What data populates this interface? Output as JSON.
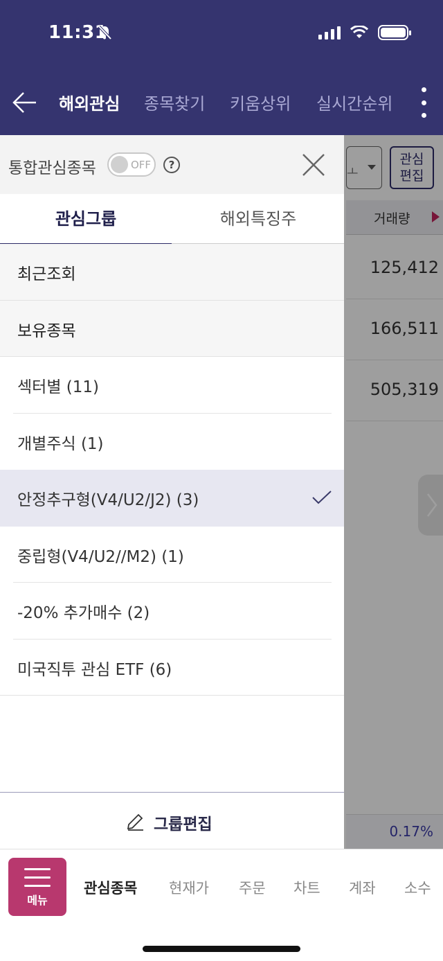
{
  "status_bar": {
    "time": "11:31"
  },
  "nav": {
    "tabs": [
      {
        "label": "해외관심",
        "active": true
      },
      {
        "label": "종목찾기",
        "active": false
      },
      {
        "label": "키움상위",
        "active": false
      },
      {
        "label": "실시간순위",
        "active": false
      }
    ]
  },
  "background": {
    "edit_button": "관심\n편집",
    "column_header": "거래량",
    "rows": [
      "125,412",
      "166,511",
      "505,319"
    ],
    "footer_percent": "0.17%",
    "select_fragment": "ㅗ"
  },
  "drawer": {
    "integrated_label": "통합관심종목",
    "toggle_text": "OFF",
    "help_text": "?",
    "tabs": [
      {
        "label": "관심그룹",
        "active": true
      },
      {
        "label": "해외특징주",
        "active": false
      }
    ],
    "items": [
      {
        "label": "최근조회"
      },
      {
        "label": "보유종목"
      },
      {
        "label": "섹터별 (11)"
      },
      {
        "label": "개별주식 (1)"
      },
      {
        "label": "안정추구형(V4/U2/J2) (3)",
        "selected": true
      },
      {
        "label": "중립형(V4/U2//M2) (1)"
      },
      {
        "label": "-20% 추가매수 (2)"
      },
      {
        "label": "미국직투 관심 ETF (6)"
      }
    ],
    "group_edit_label": "그룹편집"
  },
  "bottom_nav": {
    "menu_label": "메뉴",
    "tabs": [
      {
        "label": "관심종목",
        "active": true
      },
      {
        "label": "현재가",
        "active": false
      },
      {
        "label": "주문",
        "active": false
      },
      {
        "label": "차트",
        "active": false
      },
      {
        "label": "계좌",
        "active": false
      },
      {
        "label": "소수",
        "active": false
      }
    ]
  },
  "colors": {
    "header_bg": "#35346f",
    "menu_button": "#b8386e",
    "selected_item_bg": "#e7e7f1"
  }
}
